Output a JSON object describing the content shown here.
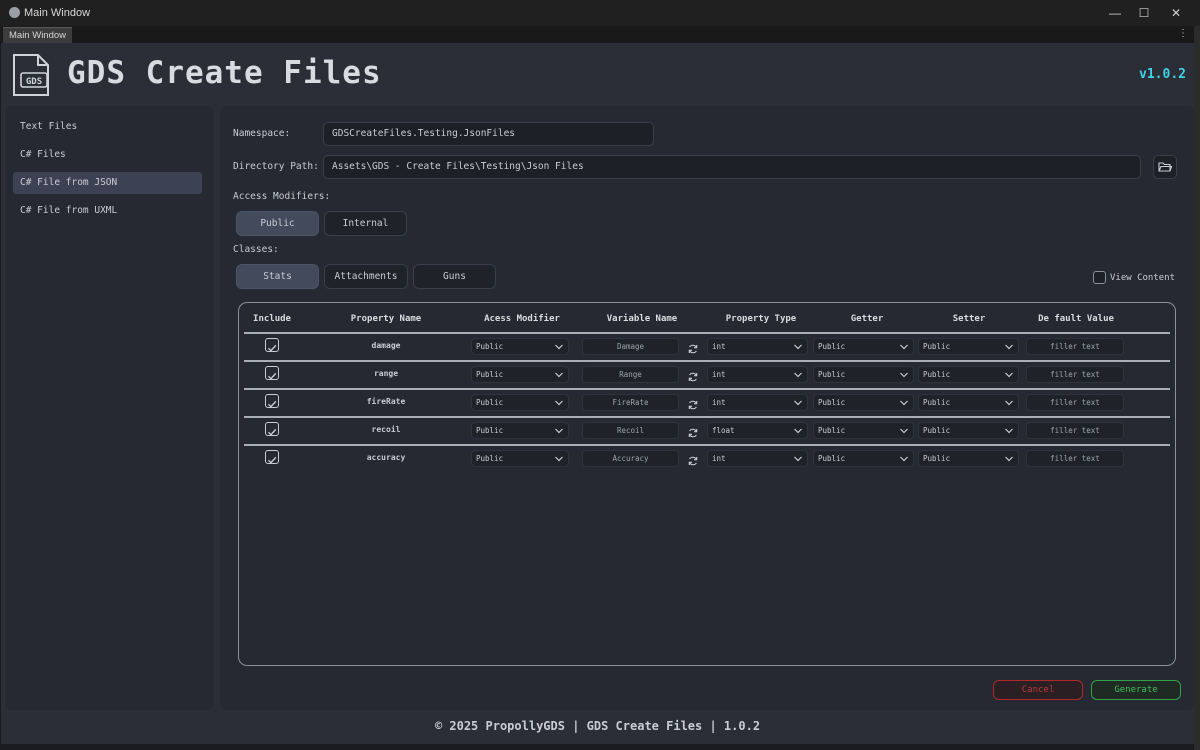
{
  "window": {
    "title": "Main Window",
    "minimize": "—",
    "maximize": "☐",
    "close": "✕"
  },
  "tabbar": {
    "tab_label": "Main Window",
    "menu": "⋮"
  },
  "header": {
    "logo_text": "GDS",
    "title": "GDS Create Files",
    "version": "v1.0.2"
  },
  "sidebar": {
    "items": [
      {
        "label": "Text Files",
        "active": false
      },
      {
        "label": "C# Files",
        "active": false
      },
      {
        "label": "C# File from JSON",
        "active": true
      },
      {
        "label": "C# File from UXML",
        "active": false
      }
    ]
  },
  "form": {
    "namespace_label": "Namespace:",
    "namespace_value": "GDSCreateFiles.Testing.JsonFiles",
    "directory_label": "Directory Path:",
    "directory_value": "Assets\\GDS - Create Files\\Testing\\Json Files",
    "access_label": "Access Modifiers:",
    "access_options": [
      "Public",
      "Internal"
    ],
    "access_selected": "Public",
    "classes_label": "Classes:",
    "classes": [
      "Stats",
      "Attachments",
      "Guns"
    ],
    "classes_selected": "Stats",
    "view_content_label": "View Content"
  },
  "table": {
    "headers": [
      "Include",
      "Property Name",
      "Acess Modifier",
      "Variable Name",
      "Property Type",
      "Getter",
      "Setter",
      "De fault Value"
    ],
    "rows": [
      {
        "include": true,
        "property": "damage",
        "access": "Public",
        "variable": "Damage",
        "type": "int",
        "getter": "Public",
        "setter": "Public",
        "default": "filler text"
      },
      {
        "include": true,
        "property": "range",
        "access": "Public",
        "variable": "Range",
        "type": "int",
        "getter": "Public",
        "setter": "Public",
        "default": "filler text"
      },
      {
        "include": true,
        "property": "fireRate",
        "access": "Public",
        "variable": "FireRate",
        "type": "int",
        "getter": "Public",
        "setter": "Public",
        "default": "filler text"
      },
      {
        "include": true,
        "property": "recoil",
        "access": "Public",
        "variable": "Recoil",
        "type": "float",
        "getter": "Public",
        "setter": "Public",
        "default": "filler text"
      },
      {
        "include": true,
        "property": "accuracy",
        "access": "Public",
        "variable": "Accuracy",
        "type": "int",
        "getter": "Public",
        "setter": "Public",
        "default": "filler text"
      }
    ]
  },
  "actions": {
    "cancel": "Cancel",
    "generate": "Generate"
  },
  "footer": {
    "text": "© 2025 PropollyGDS | GDS Create Files | 1.0.2"
  },
  "colors": {
    "accent_version": "#3fd4e6",
    "cancel": "#c23a3a",
    "generate": "#3fbf5a",
    "panel": "#262931",
    "background": "#2b2e37"
  }
}
